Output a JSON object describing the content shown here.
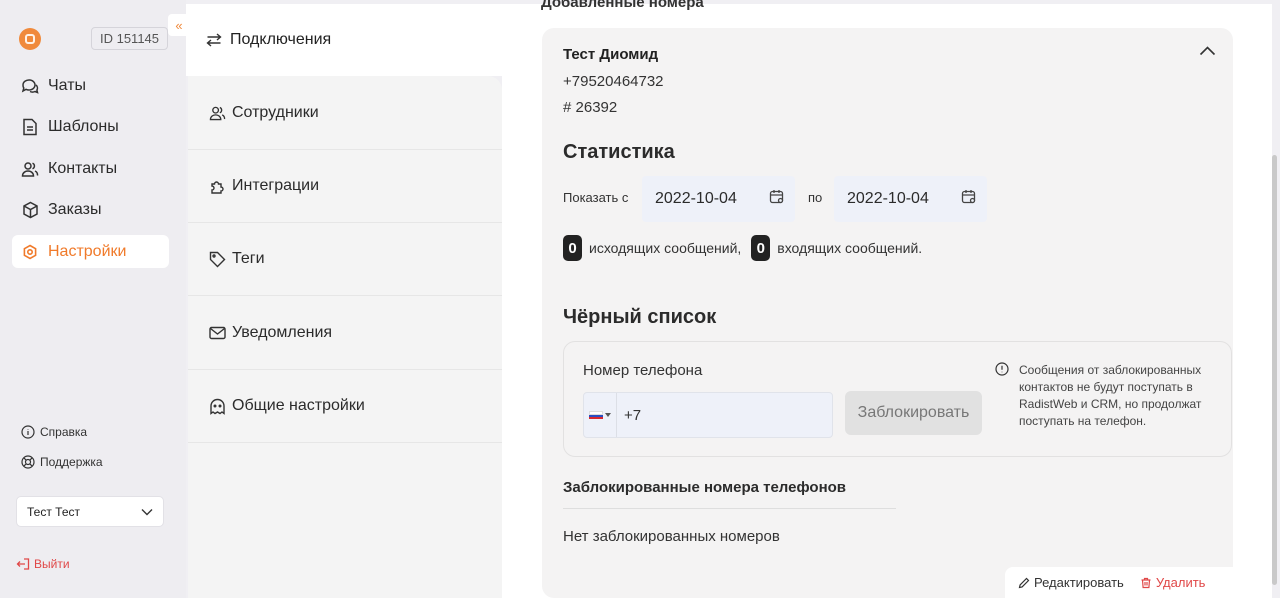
{
  "sidebar": {
    "account_id": "ID 151145",
    "collapse_glyph": "«",
    "nav": [
      {
        "label": "Чаты",
        "icon": "chats-icon"
      },
      {
        "label": "Шаблоны",
        "icon": "templates-icon"
      },
      {
        "label": "Контакты",
        "icon": "contacts-icon"
      },
      {
        "label": "Заказы",
        "icon": "orders-icon"
      },
      {
        "label": "Настройки",
        "icon": "settings-icon",
        "active": true
      }
    ],
    "help_label": "Справка",
    "support_label": "Поддержка",
    "user_name": "Тест Тест",
    "logout_label": "Выйти",
    "accent_color": "#f07a2a"
  },
  "settings_menu": {
    "items": [
      {
        "label": "Подключения",
        "icon": "connections-icon",
        "active": true
      },
      {
        "label": "Сотрудники",
        "icon": "employees-icon"
      },
      {
        "label": "Интеграции",
        "icon": "integrations-icon"
      },
      {
        "label": "Теги",
        "icon": "tag-icon"
      },
      {
        "label": "Уведомления",
        "icon": "mail-icon"
      },
      {
        "label": "Общие настройки",
        "icon": "general-settings-icon"
      }
    ]
  },
  "main": {
    "section_title": "Добавленные номера",
    "contact": {
      "name": "Тест Диомид",
      "phone": "+79520464732",
      "id": "# 26392"
    },
    "stats": {
      "title": "Статистика",
      "from_label": "Показать с",
      "from_date": "2022-10-04",
      "to_label": "по",
      "to_date": "2022-10-04",
      "outgoing_count": "0",
      "outgoing_label": "исходящих сообщений,",
      "incoming_count": "0",
      "incoming_label": "входящих сообщений."
    },
    "blacklist": {
      "title": "Чёрный список",
      "phone_label": "Номер телефона",
      "phone_value": "+7",
      "block_button": "Заблокировать",
      "info": "Сообщения от заблокированных контактов не будут поступать в RadistWeb и CRM, но продолжат поступать на телефон.",
      "blocked_title": "Заблокированные номера телефонов",
      "blocked_empty": "Нет заблокированных номеров"
    },
    "actions": {
      "edit": "Редактировать",
      "delete": "Удалить",
      "delete_color": "#e04848"
    }
  }
}
